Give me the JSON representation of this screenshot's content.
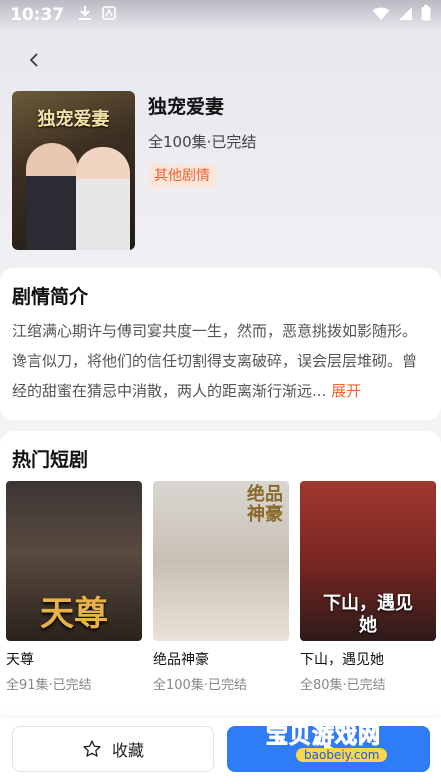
{
  "status_bar": {
    "time": "10:37"
  },
  "drama": {
    "title": "独宠爱妻",
    "poster_title": "独宠爱妻",
    "meta": "全100集·已完结",
    "genre": "其他剧情"
  },
  "synopsis": {
    "heading": "剧情简介",
    "text": "江绾满心期许与傅司宴共度一生，然而，恶意挑拨如影随形。谗言似刀，将他们的信任切割得支离破碎，误会层层堆砌。曾经的甜蜜在猜忌中消散，两人的距离渐行渐远...",
    "expand_label": "展开"
  },
  "hot": {
    "heading": "热门短剧",
    "items": [
      {
        "name": "天尊",
        "meta": "全91集·已完结",
        "caption": "天尊"
      },
      {
        "name": "绝品神豪",
        "meta": "全100集·已完结",
        "caption": "绝品神豪"
      },
      {
        "name": "下山，遇见她",
        "meta": "全80集·已完结",
        "caption": "下山，遇见她"
      }
    ]
  },
  "bottom_bar": {
    "collect_label": "收藏"
  },
  "watermark": {
    "main": "宝贝游戏网",
    "sub": "baobeiy.com"
  },
  "colors": {
    "accent_orange": "#f0632f",
    "primary_blue": "#2e7cf6"
  }
}
